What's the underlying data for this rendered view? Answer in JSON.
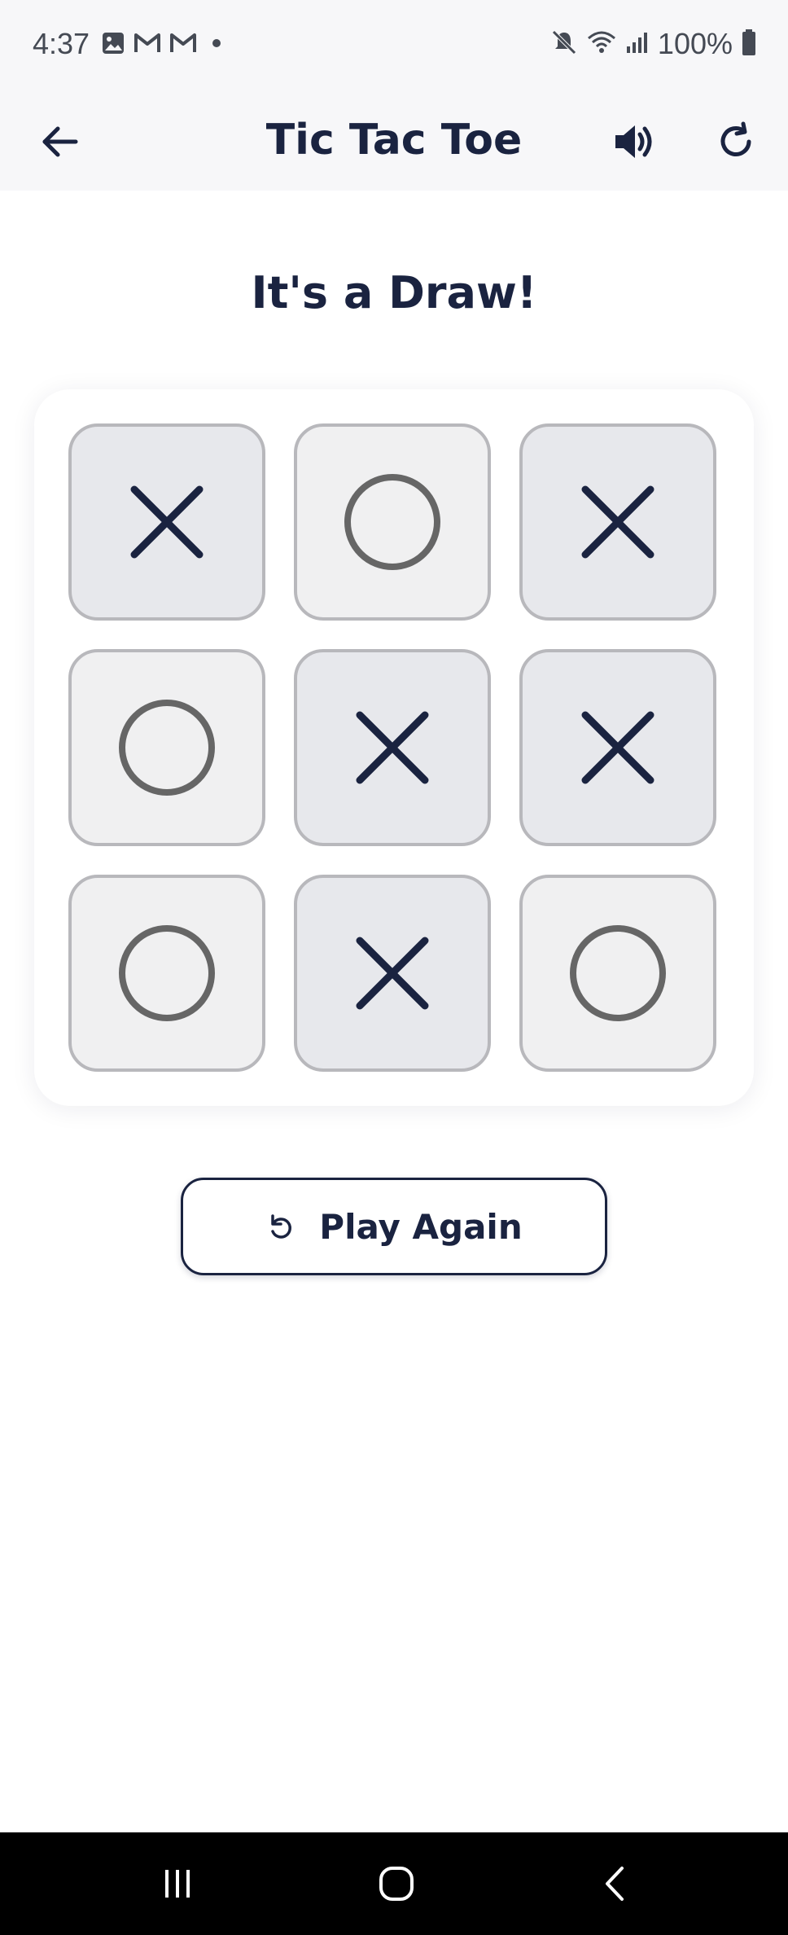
{
  "status_bar": {
    "time": "4:37",
    "battery": "100%",
    "left_icons": [
      "gallery-icon",
      "gmail-icon",
      "gmail-icon",
      "notification-dot-icon"
    ],
    "right_icons": [
      "mute-icon",
      "wifi-icon",
      "signal-icon",
      "battery-icon"
    ]
  },
  "header": {
    "title": "Tic Tac Toe",
    "back_icon": "arrow-left-icon",
    "sound_icon": "volume-icon",
    "refresh_icon": "refresh-icon"
  },
  "game": {
    "status": "It's a Draw!",
    "board": [
      [
        "X",
        "O",
        "X"
      ],
      [
        "O",
        "X",
        "X"
      ],
      [
        "O",
        "X",
        "O"
      ]
    ]
  },
  "play_again": {
    "label": "Play Again",
    "icon": "replay-icon"
  },
  "nav_bar": {
    "icons": [
      "recents-icon",
      "home-icon",
      "back-icon"
    ]
  },
  "colors": {
    "navy": "#1a2340",
    "o_mark": "#666666",
    "x_cell_bg": "#e7e8ec",
    "o_cell_bg": "#f0f0f1",
    "cell_border": "#b8b8bc",
    "header_bg": "#f7f7f9"
  }
}
